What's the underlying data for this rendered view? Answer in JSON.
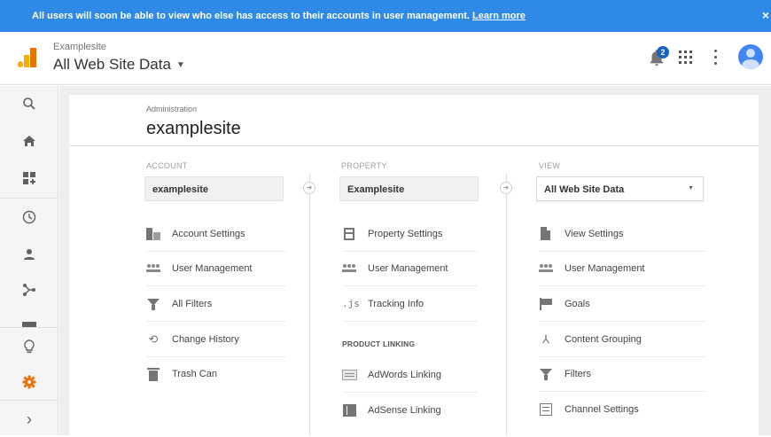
{
  "banner": {
    "message": "All users will soon be able to view who else has access to their accounts in user management.",
    "link": "Learn more",
    "close": "×"
  },
  "header": {
    "account_name": "Examplesite",
    "view_name": "All Web Site Data",
    "notification_count": "2",
    "icons": [
      "analytics-logo-icon",
      "notification-bell-icon",
      "apps-grid-icon",
      "more-vert-icon",
      "avatar-icon"
    ]
  },
  "leftnav": {
    "items": [
      "search-icon",
      "home-icon",
      "dashboards-icon",
      "realtime-clock-icon",
      "audience-person-icon",
      "acquisition-icon",
      "reports-icon",
      "discover-lightbulb-icon",
      "admin-gear-icon",
      "expand-chevron-icon"
    ],
    "active": "admin-gear-icon",
    "accent": "#e8710a",
    "expand_glyph": "›"
  },
  "page": {
    "admin_label": "Administration",
    "title": "examplesite"
  },
  "account_col": {
    "label": "ACCOUNT",
    "selected": "examplesite",
    "items": [
      "Account Settings",
      "User Management",
      "All Filters",
      "Change History",
      "Trash Can"
    ]
  },
  "property_col": {
    "label": "PROPERTY",
    "selected": "Examplesite",
    "items": [
      "Property Settings",
      "User Management",
      "Tracking Info"
    ],
    "js_glyph": ".js",
    "section_label": "PRODUCT LINKING",
    "linking_items": [
      "AdWords Linking",
      "AdSense Linking"
    ]
  },
  "view_col": {
    "label": "VIEW",
    "selected": "All Web Site Data",
    "items": [
      "View Settings",
      "User Management",
      "Goals",
      "Content Grouping",
      "Filters",
      "Channel Settings"
    ]
  },
  "colors": {
    "banner": "#2e8ae6",
    "logo_light": "#f9ab00",
    "logo_dark": "#e37400",
    "badge": "#1565c0"
  }
}
